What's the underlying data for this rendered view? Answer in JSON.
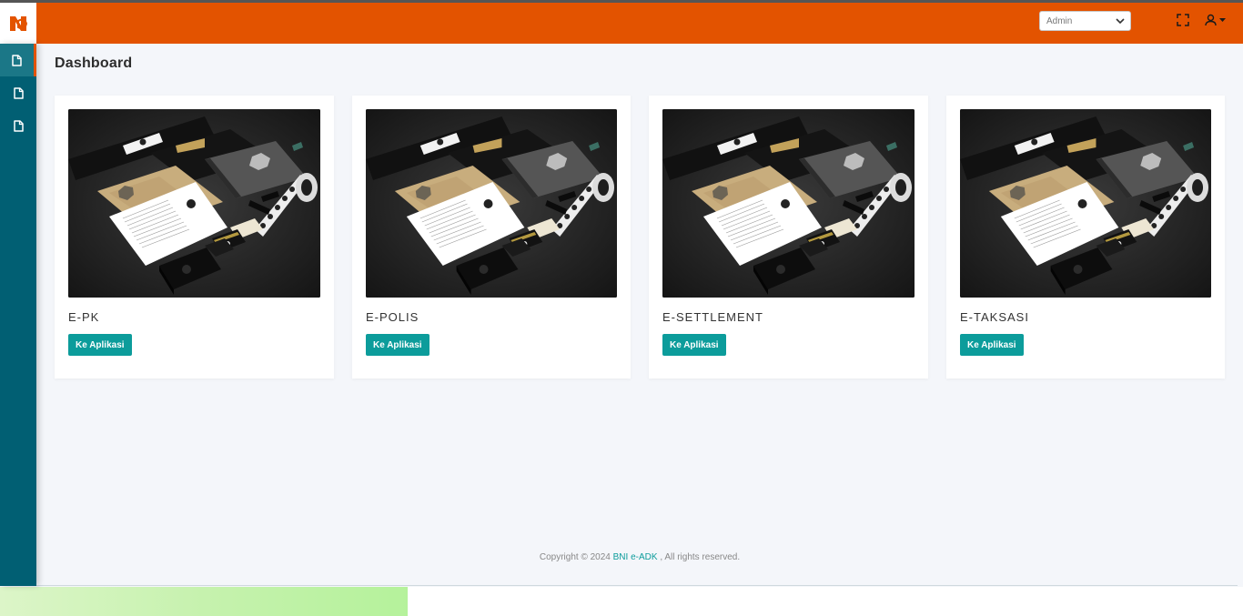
{
  "header": {
    "role_select": {
      "selected": "Admin",
      "options": [
        "Admin"
      ]
    },
    "fullscreen_icon": "fullscreen-icon",
    "user_icon": "user-icon",
    "brand_color": "#e35300"
  },
  "sidebar": {
    "items": [
      {
        "icon": "file-icon",
        "active": true
      },
      {
        "icon": "file-icon",
        "active": false
      },
      {
        "icon": "file-icon",
        "active": false
      }
    ],
    "color": "#015f73"
  },
  "main": {
    "title": "Dashboard",
    "cards": [
      {
        "title": "E-PK",
        "button_label": "Ke Aplikasi"
      },
      {
        "title": "E-POLIS",
        "button_label": "Ke Aplikasi"
      },
      {
        "title": "E-SETTLEMENT",
        "button_label": "Ke Aplikasi"
      },
      {
        "title": "E-TAKSASI",
        "button_label": "Ke Aplikasi"
      }
    ],
    "button_color": "#0c9c9b"
  },
  "footer": {
    "prefix": "Copyright © 2024",
    "brand": "BNI e-ADK",
    "suffix": ", All rights reserved."
  }
}
